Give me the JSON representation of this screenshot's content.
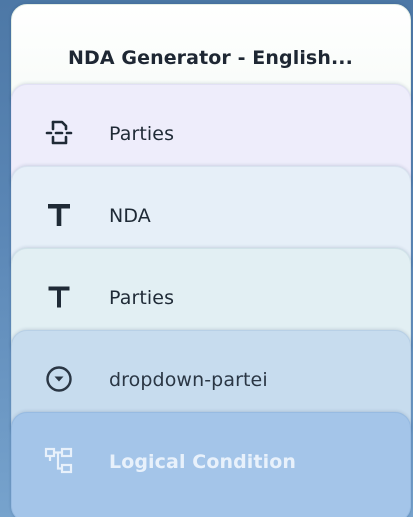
{
  "header": {
    "title": "NDA Generator - English..."
  },
  "items": [
    {
      "label": "Parties",
      "icon": "parties-block-icon"
    },
    {
      "label": "NDA",
      "icon": "text-t-icon"
    },
    {
      "label": "Parties",
      "icon": "text-t-icon"
    },
    {
      "label": "dropdown-partei",
      "icon": "dropdown-circle-icon"
    },
    {
      "label": "Logical Condition",
      "icon": "logic-flow-icon"
    }
  ],
  "colors": {
    "background": "#5b87b6",
    "text_dark": "#1f2a36",
    "disabled_text": "#e8f1fb"
  }
}
